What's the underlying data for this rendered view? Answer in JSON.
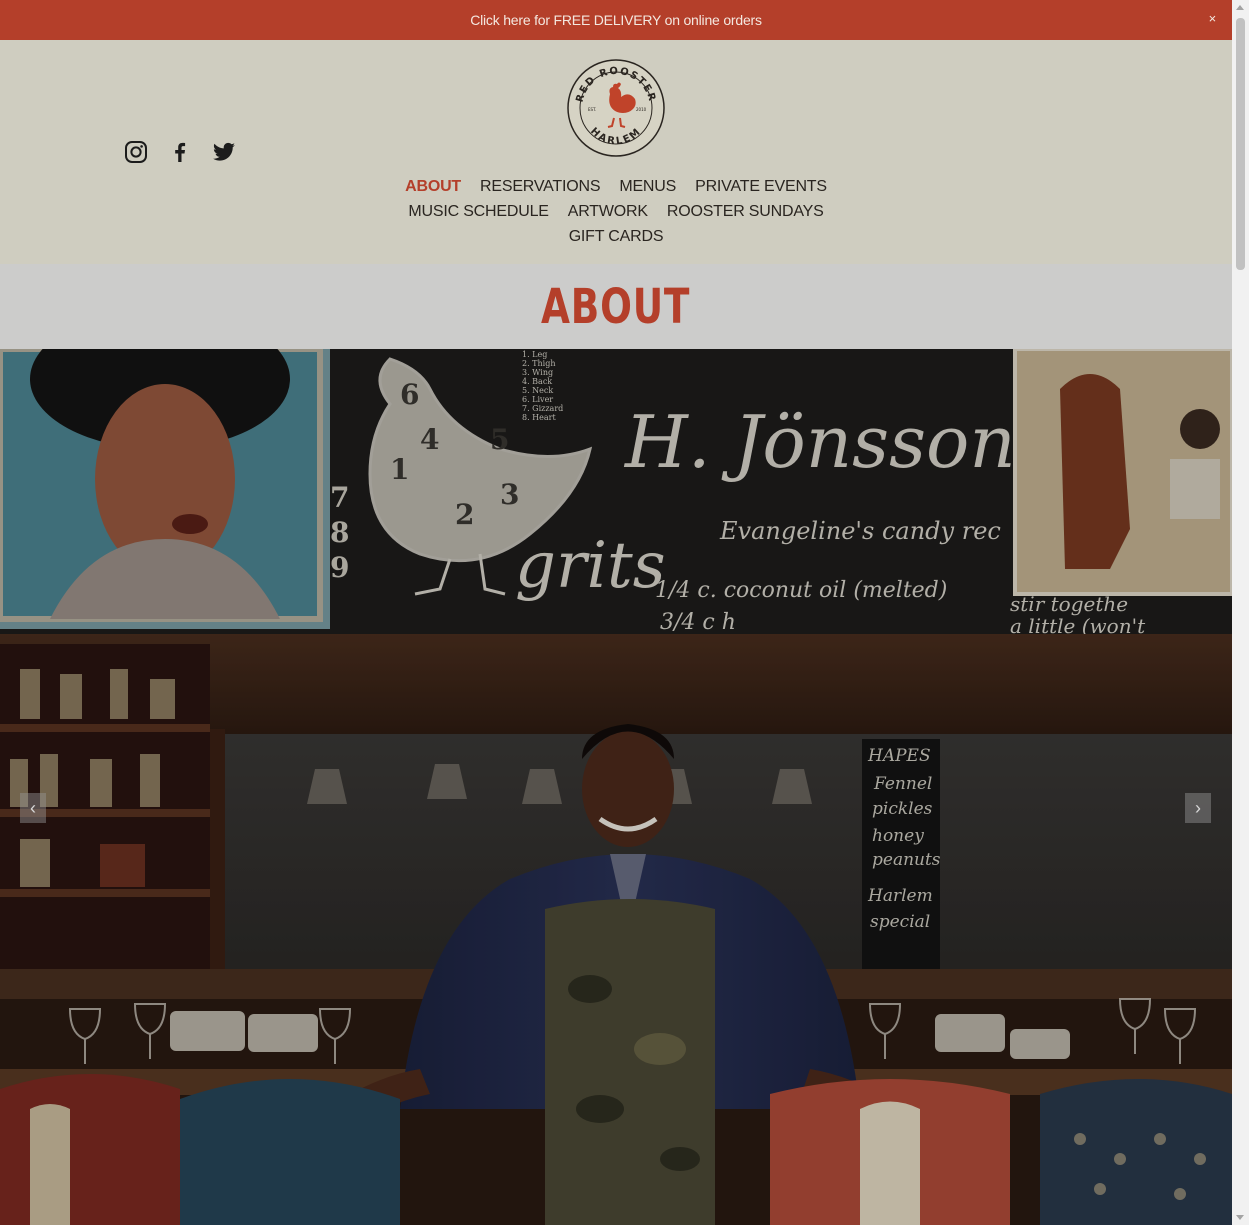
{
  "banner": {
    "text": "Click here for FREE DELIVERY on online orders",
    "close": "×"
  },
  "logo": {
    "top_text": "RED ROOSTER",
    "bottom_text": "HARLEM",
    "left_text": "EST.",
    "right_text": "2010"
  },
  "social": [
    "instagram-icon",
    "facebook-icon",
    "twitter-icon"
  ],
  "nav": {
    "row1": [
      "ABOUT",
      "RESERVATIONS",
      "MENUS",
      "PRIVATE EVENTS"
    ],
    "row2": [
      "MUSIC SCHEDULE",
      "ARTWORK",
      "ROOSTER SUNDAYS"
    ],
    "row3": [
      "GIFT CARDS"
    ],
    "active": "ABOUT"
  },
  "page": {
    "title": "ABOUT"
  },
  "hero": {
    "chalk_name": "H. Jönsson",
    "chalk_grits": "grits",
    "chalk_recipe_1": "Evangeline's candy rec",
    "chalk_recipe_2": "1/4 c. coconut oil (melted)",
    "chalk_recipe_3": "3/4 c h",
    "chalk_recipe_4": "stir togethe",
    "chalk_recipe_5": "a little (won't",
    "pillar_text": [
      "HAPES",
      "Fennel",
      "pickles",
      "honey",
      "peanuts",
      "Harlem",
      "special"
    ],
    "parts_list": [
      "1. Leg",
      "2. Thigh",
      "3. Wing",
      "4. Back",
      "5. Neck",
      "6. Liver",
      "7. Gizzard",
      "8. Heart"
    ],
    "numbers": [
      "6",
      "4",
      "5",
      "1",
      "3",
      "2",
      "7",
      "8",
      "9"
    ],
    "prev": "‹",
    "next": "›"
  },
  "colors": {
    "brand_red": "#b43f2a",
    "header_bg": "#cfcdc0",
    "title_band_bg": "#cccccb"
  }
}
